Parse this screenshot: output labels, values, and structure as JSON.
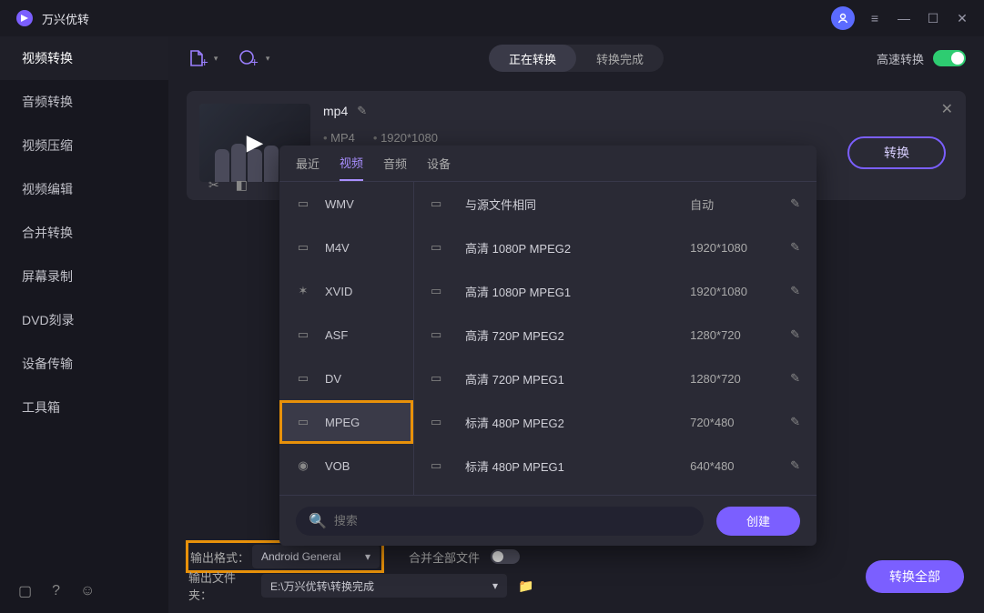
{
  "app": {
    "title": "万兴优转"
  },
  "sidebar": {
    "items": [
      "视频转换",
      "音频转换",
      "视频压缩",
      "视频编辑",
      "合并转换",
      "屏幕录制",
      "DVD刻录",
      "设备传输",
      "工具箱"
    ]
  },
  "toolbar": {
    "seg": {
      "converting": "正在转换",
      "done": "转换完成"
    },
    "fast": "高速转换"
  },
  "file": {
    "name": "mp4",
    "format": "MP4",
    "resolution": "1920*1080"
  },
  "convert": "转换",
  "popup": {
    "tabs": [
      "最近",
      "视频",
      "音频",
      "设备"
    ],
    "formats": [
      "WMV",
      "M4V",
      "XVID",
      "ASF",
      "DV",
      "MPEG",
      "VOB"
    ],
    "presets": [
      {
        "name": "与源文件相同",
        "dim": "自动"
      },
      {
        "name": "高清 1080P MPEG2",
        "dim": "1920*1080"
      },
      {
        "name": "高清 1080P MPEG1",
        "dim": "1920*1080"
      },
      {
        "name": "高清 720P MPEG2",
        "dim": "1280*720"
      },
      {
        "name": "高清 720P MPEG1",
        "dim": "1280*720"
      },
      {
        "name": "标清 480P MPEG2",
        "dim": "720*480"
      },
      {
        "name": "标清 480P MPEG1",
        "dim": "640*480"
      }
    ],
    "search_ph": "搜索",
    "create": "创建"
  },
  "bottom": {
    "out_format": "输出格式：",
    "out_format_val": "Android General",
    "merge": "合并全部文件",
    "out_path": "输出文件夹：",
    "out_path_val": "E:\\万兴优转\\转换完成",
    "convert_all": "转换全部"
  }
}
